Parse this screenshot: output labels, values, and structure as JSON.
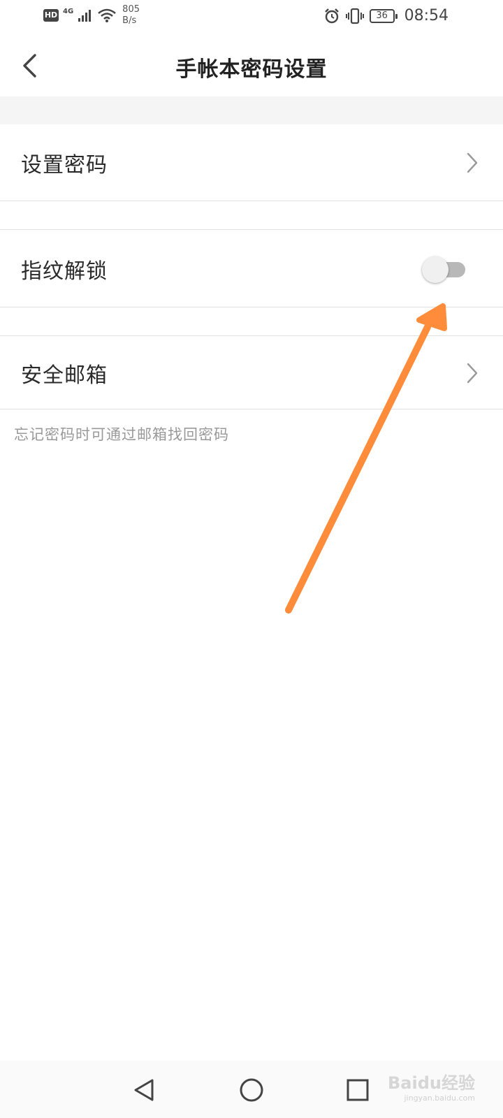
{
  "status_bar": {
    "hd_label": "HD",
    "network_type": "4G",
    "speed_value": "805",
    "speed_unit": "B/s",
    "battery_level": "36",
    "time": "08:54"
  },
  "header": {
    "title": "手帐本密码设置",
    "back_icon": "chevron-left-icon"
  },
  "settings": {
    "set_password_label": "设置密码",
    "fingerprint_label": "指纹解锁",
    "fingerprint_enabled": false,
    "secure_email_label": "安全邮箱",
    "email_hint": "忘记密码时可通过邮箱找回密码"
  },
  "annotation": {
    "arrow_color": "#FF8C3A"
  },
  "nav_bar": {
    "back_icon": "triangle-back-icon",
    "home_icon": "circle-home-icon",
    "recents_icon": "square-recents-icon"
  },
  "watermark": {
    "brand": "Baidu经验",
    "url": "jingyan.baidu.com"
  }
}
